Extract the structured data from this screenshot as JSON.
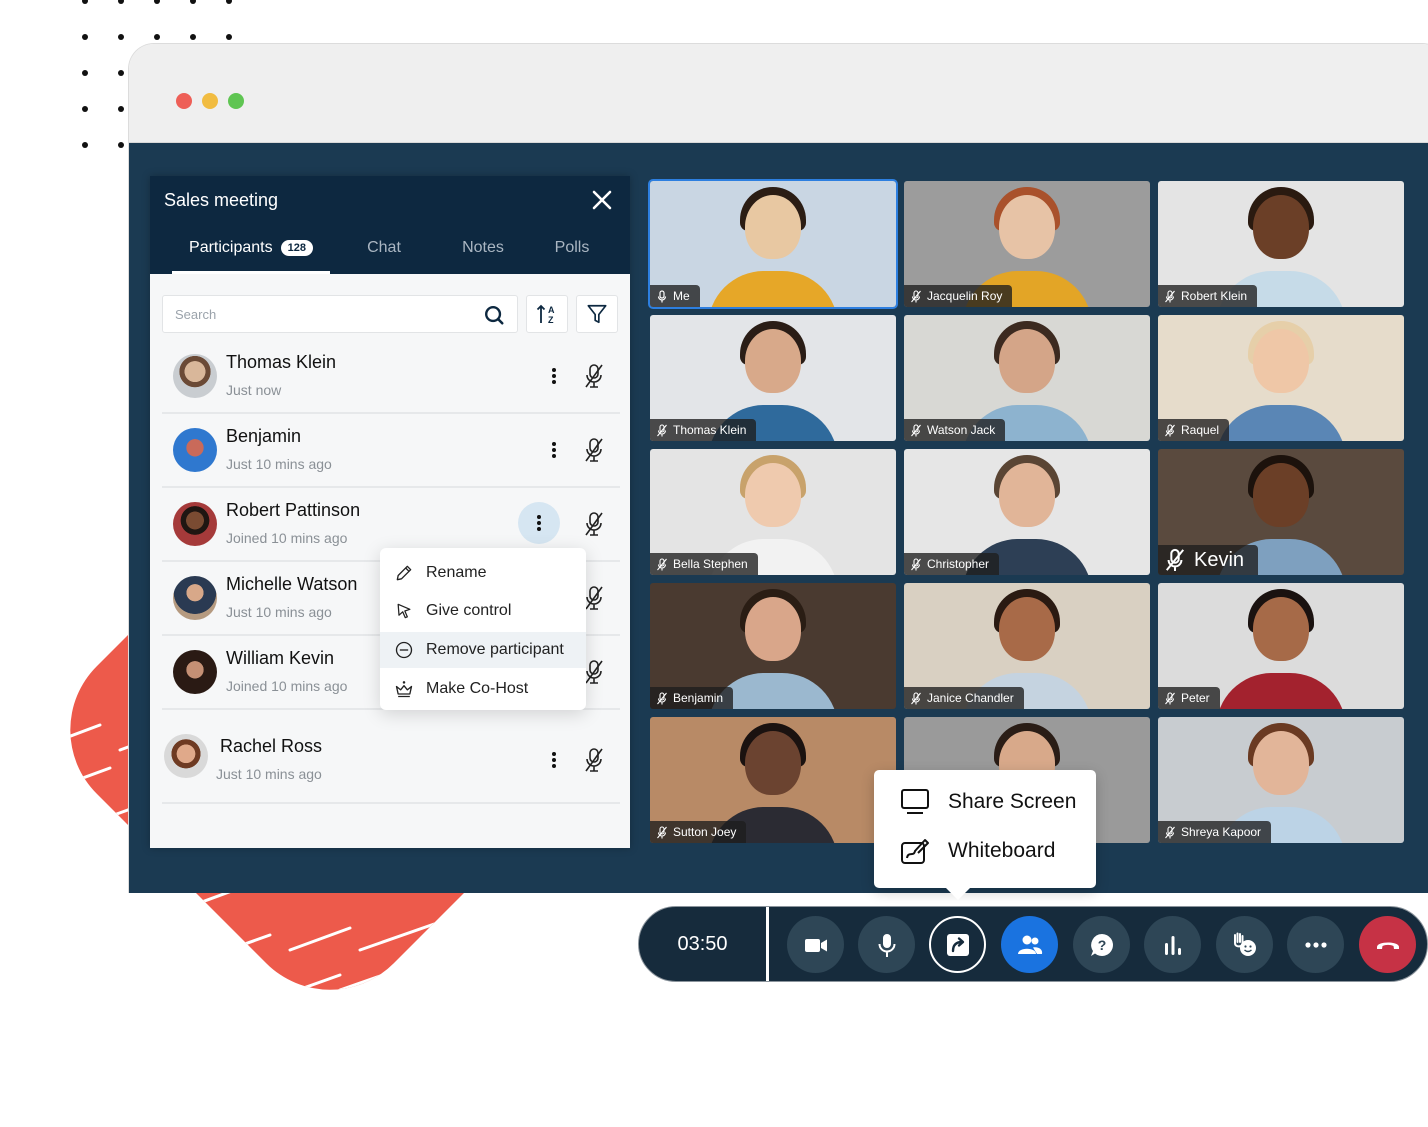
{
  "window": {
    "traffic_lights": {
      "close": "#ee5f57",
      "minimize": "#f1bc41",
      "maximize": "#5fc552"
    }
  },
  "panel": {
    "title": "Sales meeting",
    "close_icon": "close-icon",
    "tabs": [
      {
        "label": "Participants",
        "badge": "128",
        "active": true
      },
      {
        "label": "Chat",
        "active": false
      },
      {
        "label": "Notes",
        "active": false
      },
      {
        "label": "Polls",
        "active": false
      }
    ],
    "search": {
      "placeholder": "Search",
      "value": ""
    },
    "participants": [
      {
        "name": "Thomas Klein",
        "status": "Just now"
      },
      {
        "name": "Benjamin",
        "status": "Just 10 mins ago"
      },
      {
        "name": "Robert Pattinson",
        "status": "Joined 10 mins ago"
      },
      {
        "name": "Michelle Watson",
        "status": "Just 10 mins ago"
      },
      {
        "name": "William Kevin",
        "status": "Joined 10 mins ago"
      },
      {
        "name": "Rachel Ross",
        "status": "Just 10 mins ago"
      }
    ],
    "context_menu": [
      {
        "label": "Rename",
        "icon": "pencil-icon"
      },
      {
        "label": "Give control",
        "icon": "cursor-icon"
      },
      {
        "label": "Remove participant",
        "icon": "minus-circle-icon",
        "highlighted": true
      },
      {
        "label": "Make Co-Host",
        "icon": "crown-icon"
      }
    ]
  },
  "video_grid": [
    {
      "name": "Me",
      "mic": "on",
      "active": true
    },
    {
      "name": "Jacquelin Roy",
      "mic": "muted"
    },
    {
      "name": "Robert Klein",
      "mic": "muted"
    },
    {
      "name": "Thomas Klein",
      "mic": "muted"
    },
    {
      "name": "Watson Jack",
      "mic": "muted"
    },
    {
      "name": "Raquel",
      "mic": "muted"
    },
    {
      "name": "Bella Stephen",
      "mic": "muted"
    },
    {
      "name": "Christopher",
      "mic": "muted"
    },
    {
      "name": "Kevin",
      "mic": "muted",
      "speaking": true
    },
    {
      "name": "Benjamin",
      "mic": "muted"
    },
    {
      "name": "Janice Chandler",
      "mic": "muted"
    },
    {
      "name": "Peter",
      "mic": "muted"
    },
    {
      "name": "Sutton Joey",
      "mic": "muted"
    },
    {
      "name": "",
      "mic": "hidden"
    },
    {
      "name": "Shreya Kapoor",
      "mic": "muted"
    }
  ],
  "share_popup": {
    "items": [
      {
        "label": "Share Screen",
        "icon": "monitor-icon"
      },
      {
        "label": "Whiteboard",
        "icon": "whiteboard-icon"
      }
    ]
  },
  "controls": {
    "timer": "03:50",
    "buttons": [
      {
        "name": "camera",
        "icon": "video-camera-icon"
      },
      {
        "name": "microphone",
        "icon": "microphone-icon"
      },
      {
        "name": "share",
        "icon": "share-screen-icon",
        "active": true
      },
      {
        "name": "participants",
        "icon": "people-icon",
        "active": true
      },
      {
        "name": "qa",
        "icon": "question-bubble-icon"
      },
      {
        "name": "polls",
        "icon": "bar-chart-icon"
      },
      {
        "name": "reactions",
        "icon": "raise-hand-icon"
      },
      {
        "name": "more",
        "icon": "more-horizontal-icon"
      },
      {
        "name": "end-call",
        "icon": "hang-up-icon"
      }
    ],
    "colors": {
      "bar": "#162b3c",
      "button": "#2e4656",
      "active": "#1a73e0",
      "end": "#c63245"
    }
  }
}
